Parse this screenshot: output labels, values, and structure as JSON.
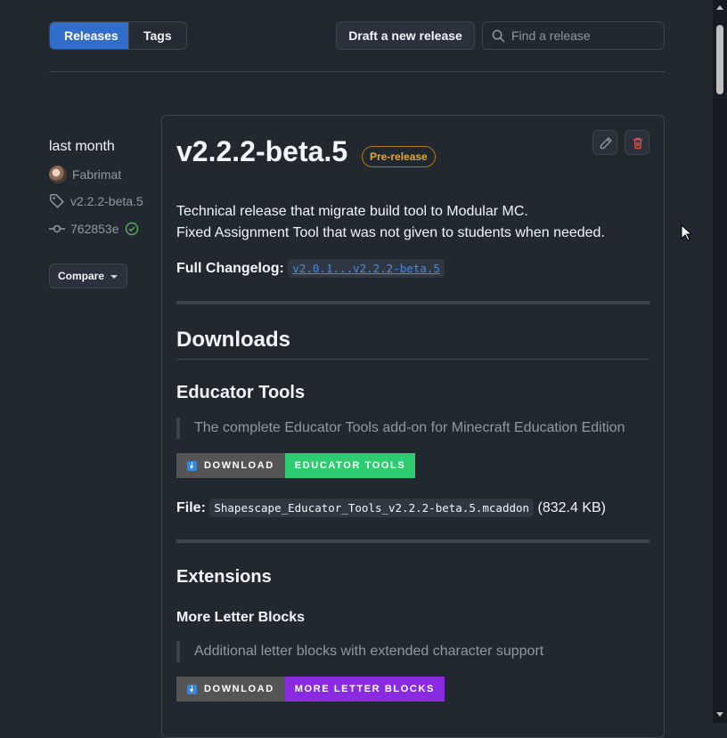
{
  "header": {
    "tabs": [
      {
        "label": "Releases"
      },
      {
        "label": "Tags"
      }
    ],
    "draft_button": "Draft a new release",
    "search_placeholder": "Find a release"
  },
  "sidebar": {
    "date": "last month",
    "author": "Fabrimat",
    "tag": "v2.2.2-beta.5",
    "commit": "762853e",
    "compare_label": "Compare"
  },
  "release": {
    "title": "v2.2.2-beta.5",
    "badge": "Pre-release",
    "desc_line1": "Technical release that migrate build tool to Modular MC.",
    "desc_line2": "Fixed Assignment Tool that was not given to students when needed.",
    "changelog_label": "Full Changelog:",
    "changelog_link": "v2.0.1...v2.2.2-beta.5",
    "downloads_heading": "Downloads",
    "educator": {
      "heading": "Educator Tools",
      "quote": "The complete Educator Tools add-on for Minecraft Education Edition",
      "badge_left": "DOWNLOAD",
      "badge_right": "EDUCATOR TOOLS",
      "badge_color": "#2ecc71",
      "file_label": "File:",
      "file_name": "Shapescape_Educator_Tools_v2.2.2-beta.5.mcaddon",
      "file_size": "(832.4 KB)"
    },
    "extensions": {
      "heading": "Extensions",
      "item_heading": "More Letter Blocks",
      "quote": "Additional letter blocks with extended character support",
      "badge_left": "DOWNLOAD",
      "badge_right": "MORE LETTER BLOCKS",
      "badge_color": "#8a2be2"
    }
  },
  "icons": [
    "search-icon",
    "tag-icon",
    "commit-icon",
    "check-circle-icon",
    "pencil-icon",
    "trash-icon",
    "download-arrow-icon"
  ]
}
